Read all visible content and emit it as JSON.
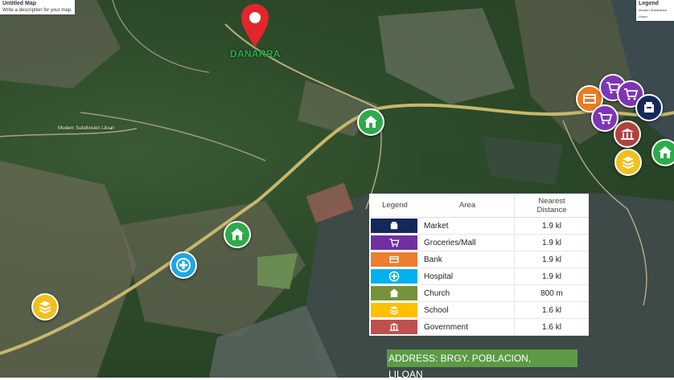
{
  "map_title": "Untitled Map",
  "map_subtitle": "Write a description for your map.",
  "legend_chip": {
    "title": "Legend",
    "subtitle": "Modern Subdivision Liloan"
  },
  "pin_label": "DANARRA",
  "place_label": "Modern Subdivision Liloan",
  "legend": {
    "headers": {
      "legend": "Legend",
      "area": "Area",
      "distance": "Nearest\nDistance"
    },
    "rows": [
      {
        "area": "Market",
        "distance": "1.9 kl",
        "color": "#14285a",
        "icon": "market-icon"
      },
      {
        "area": "Groceries/Mall",
        "distance": "1.9 kl",
        "color": "#7030a0",
        "icon": "cart-icon"
      },
      {
        "area": "Bank",
        "distance": "1.9 kl",
        "color": "#ed7d31",
        "icon": "bank-card-icon"
      },
      {
        "area": "Hospital",
        "distance": "1.9 kl",
        "color": "#00b0f0",
        "icon": "hospital-icon"
      },
      {
        "area": "Church",
        "distance": "800 m",
        "color": "#76923c",
        "icon": "church-icon"
      },
      {
        "area": "School",
        "distance": "1.6 kl",
        "color": "#ffc000",
        "icon": "school-icon"
      },
      {
        "area": "Government",
        "distance": "1.6 kl",
        "color": "#c0504d",
        "icon": "government-icon"
      }
    ]
  },
  "address": {
    "line1": "ADDRESS: BRGY. POBLACION,",
    "line2": "LILOAN"
  },
  "colors": {
    "pin": "#e3262b",
    "church": "#2eaa4a",
    "hospital": "#1ea6e6",
    "school": "#f2c01d",
    "bank": "#ee7a22",
    "grocery": "#7d35b5",
    "government": "#b3413e",
    "market": "#14285a"
  }
}
